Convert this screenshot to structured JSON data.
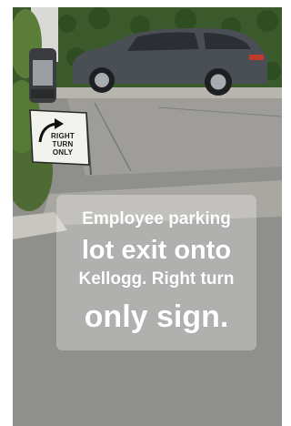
{
  "photo": {
    "description_icon": "parked-car-and-driveway-photo"
  },
  "sign": {
    "icon": "curved-right-arrow-icon",
    "lines": [
      "RIGHT",
      "TURN",
      "ONLY"
    ]
  },
  "caption": {
    "lines": [
      "Employee parking",
      "lot exit onto",
      "Kellogg. Right turn",
      "only sign."
    ]
  },
  "colors": {
    "caption_text": "#ffffff",
    "caption_box": "rgba(255,255,255,0.30)",
    "hedge": "#2f4d24",
    "asphalt": "#8c8c8a",
    "car": "#4a4f55"
  }
}
